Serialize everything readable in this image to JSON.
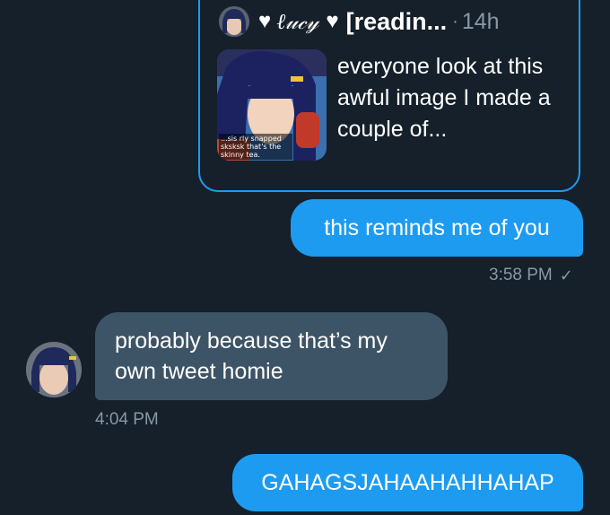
{
  "quoted_tweet": {
    "name_fancy": "ℓ𝓊𝒸𝓎",
    "handle": "[readin...",
    "separator": "·",
    "time_ago": "14h",
    "text": "everyone look at this awful image I made a couple of...",
    "thumbnail_caption": "...sis rly snapped sksksk that's the skinny tea.",
    "icons": [
      "heart-icon",
      "heart-icon"
    ]
  },
  "messages": [
    {
      "direction": "sent",
      "text": "this reminds me of you",
      "time": "3:58 PM",
      "read_icon": "check-icon"
    },
    {
      "direction": "received",
      "text": "probably because that’s my own tweet homie",
      "time": "4:04 PM"
    },
    {
      "direction": "sent",
      "text": "GAHAGSJAHAAHAHHAHAP"
    }
  ],
  "colors": {
    "background": "#15202b",
    "sent_bubble": "#1d9bf0",
    "received_bubble": "#3d5466",
    "muted_text": "#8899a6",
    "quote_border": "#1d9bf0"
  }
}
